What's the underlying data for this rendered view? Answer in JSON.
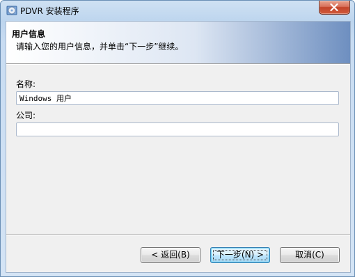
{
  "window": {
    "title": "PDVR 安装程序"
  },
  "header": {
    "title": "用户信息",
    "subtitle": "请输入您的用户信息，并单击“下一步”继续。"
  },
  "form": {
    "name_label": "名称:",
    "name_value": "Windows 用户",
    "company_label": "公司:",
    "company_value": ""
  },
  "buttons": {
    "back": "< 返回(B)",
    "next": "下一步(N) >",
    "cancel": "取消(C)"
  },
  "icons": {
    "app": "installer-cd-icon",
    "close": "close-icon"
  },
  "colors": {
    "close_button": "#c3442a",
    "header_gradient_end": "#6e8fc0",
    "default_button_border": "#3c7fb1"
  }
}
